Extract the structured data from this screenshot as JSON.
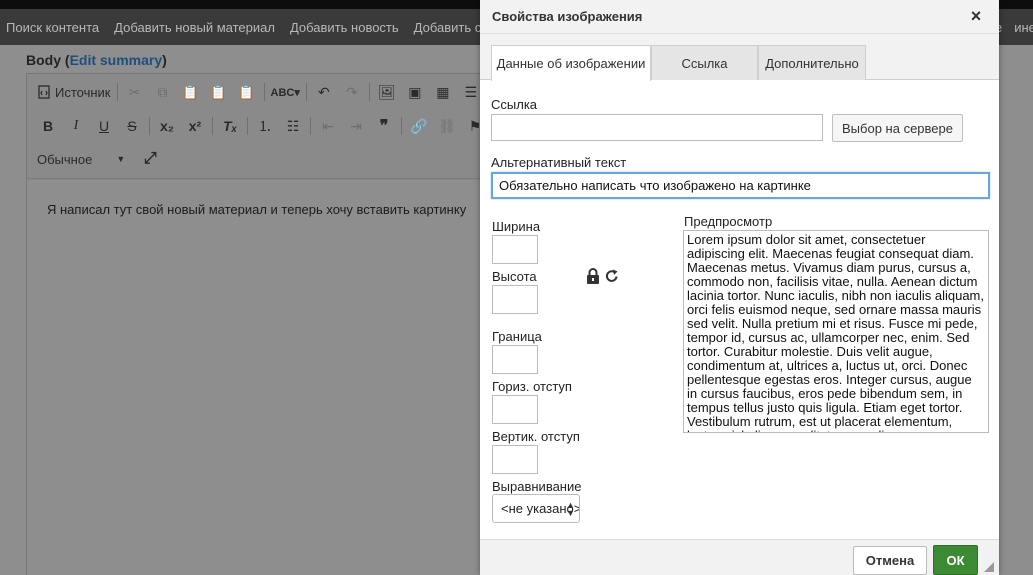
{
  "navbar": {
    "items": [
      "Поиск контента",
      "Добавить новый материал",
      "Добавить новость",
      "Добавить специал"
    ],
    "right_items": [
      "е",
      "ине"
    ]
  },
  "field": {
    "label": "Body",
    "edit_summary": "Edit summary"
  },
  "toolbar": {
    "source_label": "Источник",
    "format_value": "Обычное"
  },
  "content": {
    "text": "Я написал тут свой новый материал и теперь хочу вставить картинку"
  },
  "dialog": {
    "title": "Свойства изображения",
    "close_symbol": "×",
    "tabs": [
      "Данные об изображении",
      "Ссылка",
      "Дополнительно"
    ],
    "active_tab": "Данные об изображении",
    "url": {
      "label": "Ссылка",
      "value": "",
      "browse_button": "Выбор на сервере"
    },
    "alt": {
      "label": "Альтернативный текст",
      "value": "Обязательно написать что изображено на картинке"
    },
    "width": {
      "label": "Ширина",
      "value": ""
    },
    "height": {
      "label": "Высота",
      "value": ""
    },
    "border": {
      "label": "Граница",
      "value": ""
    },
    "hspace": {
      "label": "Гориз. отступ",
      "value": ""
    },
    "vspace": {
      "label": "Вертик. отступ",
      "value": ""
    },
    "align": {
      "label": "Выравнивание",
      "selected": "<не указано>"
    },
    "preview": {
      "label": "Предпросмотр",
      "text": "Lorem ipsum dolor sit amet, consectetuer adipiscing elit. Maecenas feugiat consequat diam. Maecenas metus. Vivamus diam purus, cursus a, commodo non, facilisis vitae, nulla. Aenean dictum lacinia tortor. Nunc iaculis, nibh non iaculis aliquam, orci felis euismod neque, sed ornare massa mauris sed velit. Nulla pretium mi et risus. Fusce mi pede, tempor id, cursus ac, ullamcorper nec, enim. Sed tortor. Curabitur molestie. Duis velit augue, condimentum at, ultrices a, luctus ut, orci. Donec pellentesque egestas eros. Integer cursus, augue in cursus faucibus, eros pede bibendum sem, in tempus tellus justo quis ligula. Etiam eget tortor. Vestibulum rutrum, est ut placerat elementum, lectus nisl aliquam velit, tempor aliquam eros nunc nonummy metus. In eros metus, gravida a, gravida sed, lobortis id, turpis. Ut ultrices, ipsum at venenatis fringilla, sem nulla lacinia tellus, eget aliquet turpis mauris non enim."
    },
    "footer": {
      "cancel": "Отмена",
      "ok": "ОК"
    }
  },
  "colors": {
    "ok_button": "#3d8a34",
    "focus_border": "#6aa7d8",
    "link": "#1d4f7d"
  }
}
